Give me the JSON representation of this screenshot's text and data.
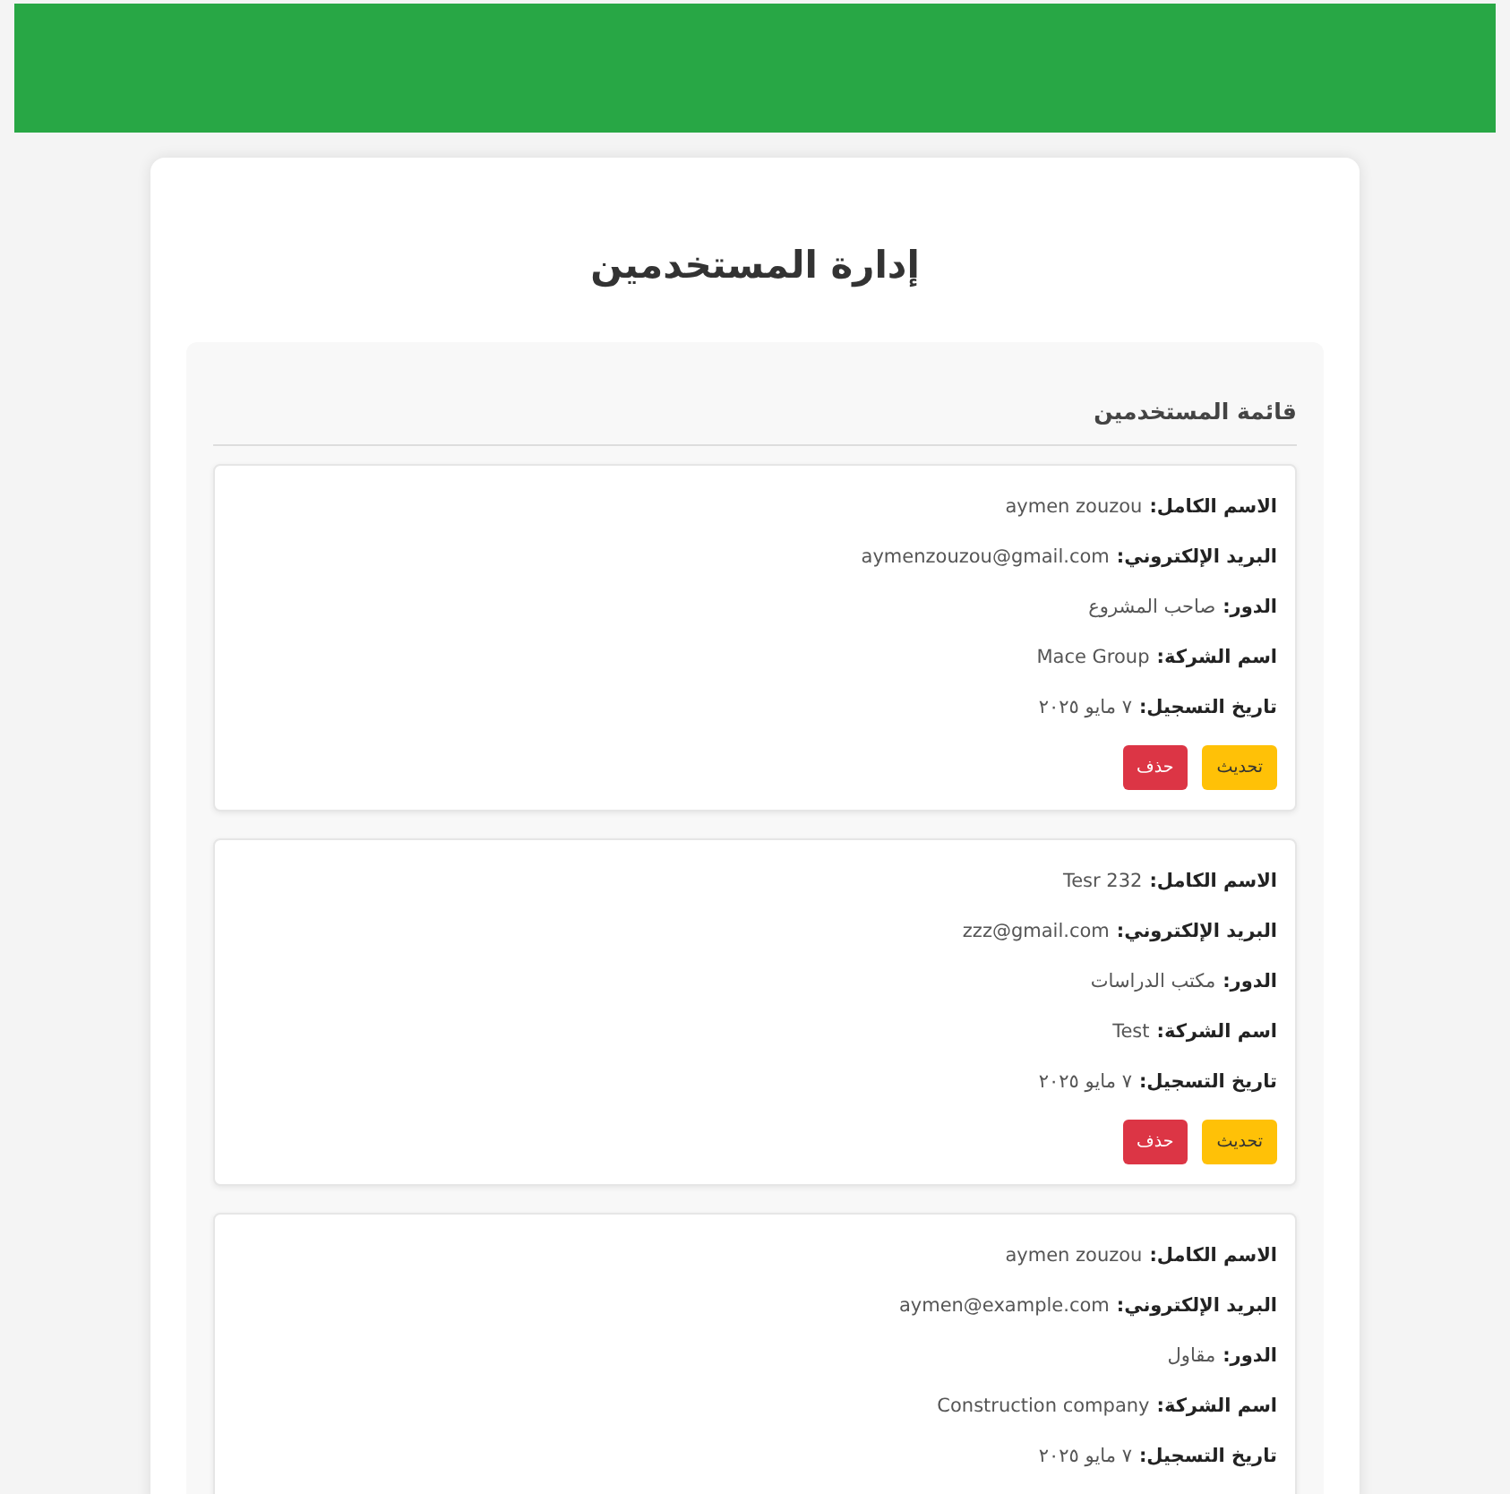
{
  "page_title": "إدارة المستخدمين",
  "section_title": "قائمة المستخدمين",
  "users": [
    {
      "fields": [
        {
          "label": "الاسم الكامل:",
          "value": "aymen zouzou"
        },
        {
          "label": "البريد الإلكتروني:",
          "value": "aymenzouzou@gmail.com"
        },
        {
          "label": "الدور:",
          "value": "صاحب المشروع"
        },
        {
          "label": "اسم الشركة:",
          "value": "Mace Group"
        },
        {
          "label": "تاريخ التسجيل:",
          "value": "٧ مايو ٢٠٢٥"
        }
      ],
      "buttons": [
        {
          "kind": "update",
          "label": "تحديث"
        },
        {
          "kind": "delete",
          "label": "حذف"
        }
      ]
    },
    {
      "fields": [
        {
          "label": "الاسم الكامل:",
          "value": "Tesr 232"
        },
        {
          "label": "البريد الإلكتروني:",
          "value": "zzz@gmail.com"
        },
        {
          "label": "الدور:",
          "value": "مكتب الدراسات"
        },
        {
          "label": "اسم الشركة:",
          "value": "Test"
        },
        {
          "label": "تاريخ التسجيل:",
          "value": "٧ مايو ٢٠٢٥"
        }
      ],
      "buttons": [
        {
          "kind": "update",
          "label": "تحديث"
        },
        {
          "kind": "delete",
          "label": "حذف"
        }
      ]
    },
    {
      "fields": [
        {
          "label": "الاسم الكامل:",
          "value": "aymen zouzou"
        },
        {
          "label": "البريد الإلكتروني:",
          "value": "aymen@example.com"
        },
        {
          "label": "الدور:",
          "value": "مقاول"
        },
        {
          "label": "اسم الشركة:",
          "value": "Construction company"
        },
        {
          "label": "تاريخ التسجيل:",
          "value": "٧ مايو ٢٠٢٥"
        }
      ]
    }
  ]
}
